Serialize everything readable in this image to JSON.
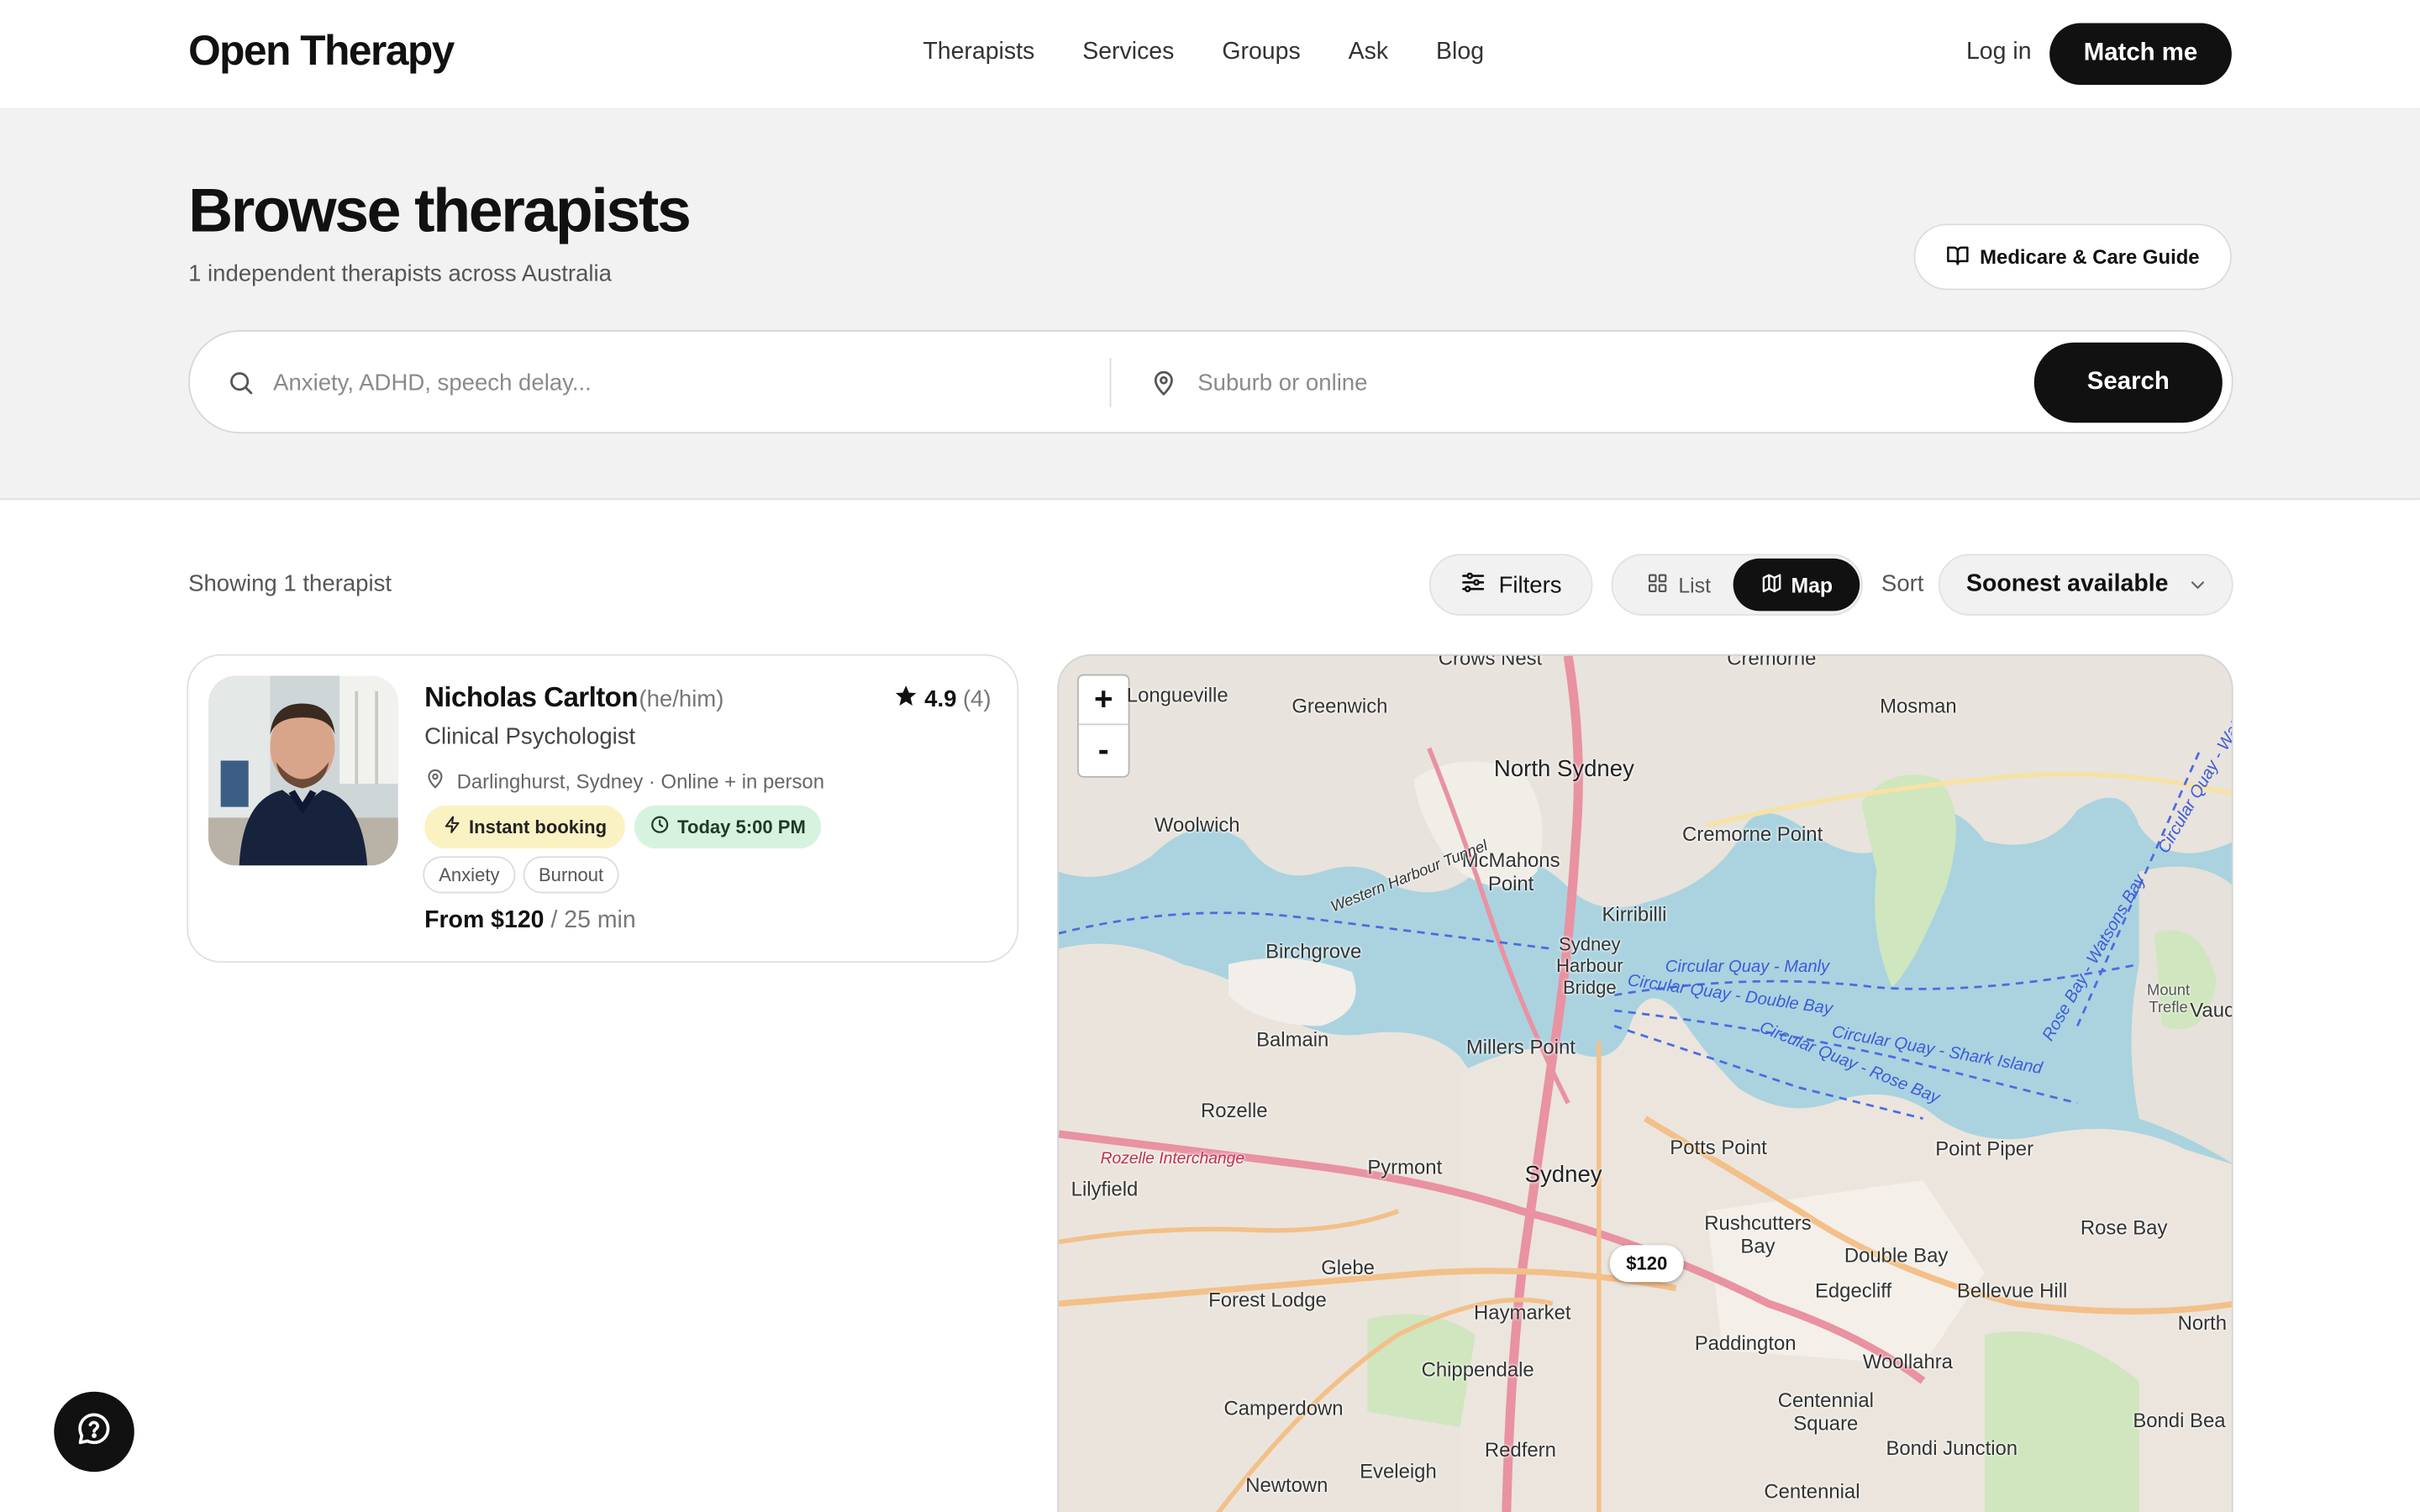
{
  "brand": "Open Therapy",
  "nav": {
    "links": [
      "Therapists",
      "Services",
      "Groups",
      "Ask",
      "Blog"
    ],
    "login": "Log in",
    "cta": "Match me"
  },
  "hero": {
    "title": "Browse therapists",
    "subtitle": "1 independent therapists across Australia",
    "guide_button": "Medicare & Care Guide",
    "search_placeholder": "Anxiety, ADHD, speech delay...",
    "location_placeholder": "Suburb or online",
    "search_button": "Search"
  },
  "results": {
    "count_text": "Showing 1 therapist",
    "filters_label": "Filters",
    "view_list_label": "List",
    "view_map_label": "Map",
    "active_view": "Map",
    "sort_label": "Sort",
    "sort_value": "Soonest available"
  },
  "therapists": [
    {
      "name": "Nicholas Carlton",
      "pronouns": "(he/him)",
      "rating": "4.9",
      "review_count": "(4)",
      "title": "Clinical Psychologist",
      "location": "Darlinghurst, Sydney · Online + in person",
      "badge_instant": "Instant booking",
      "badge_time": "Today 5:00 PM",
      "tags": [
        "Anxiety",
        "Burnout"
      ],
      "price": "From $120",
      "duration": "/ 25 min"
    }
  ],
  "map": {
    "zoom_in": "+",
    "zoom_out": "-",
    "price_pin": "$120",
    "labels": {
      "crows_nest": "Crows Nest",
      "cremorne": "Cremorne",
      "longueville": "Longueville",
      "greenwich": "Greenwich",
      "mosman": "Mosman",
      "north_sydney": "North Sydney",
      "woolwich": "Woolwich",
      "mcmahons_point": "McMahons Point",
      "cremorne_point": "Cremorne Point",
      "kirribilli": "Kirribilli",
      "birchgrove": "Birchgrove",
      "sydney_harbour_bridge": "Sydney Harbour Bridge",
      "balmain": "Balmain",
      "millers_point": "Millers Point",
      "rozelle": "Rozelle",
      "rozelle_interchange": "Rozelle Interchange",
      "lilyfield": "Lilyfield",
      "pyrmont": "Pyrmont",
      "sydney": "Sydney",
      "potts_point": "Potts Point",
      "point_piper": "Point Piper",
      "rose_bay": "Rose Bay",
      "rushcutters_bay": "Rushcutters Bay",
      "double_bay": "Double Bay",
      "glebe": "Glebe",
      "forest_lodge": "Forest Lodge",
      "haymarket": "Haymarket",
      "edgecliff": "Edgecliff",
      "bellevue_hill": "Bellevue Hill",
      "paddington": "Paddington",
      "woollahra": "Woollahra",
      "chippendale": "Chippendale",
      "camperdown": "Camperdown",
      "centennial_square": "Centennial Square",
      "redfern": "Redfern",
      "bondi_junction": "Bondi Junction",
      "newtown": "Newtown",
      "eveleigh": "Eveleigh",
      "centennial": "Centennial",
      "vaucluse": "Vauc",
      "mount_trefle": "Mount Trefle",
      "north": "North",
      "bondi_beach": "Bondi Bea",
      "western_harbour_tunnel": "Western Harbour Tunnel",
      "ferry_manly": "Circular Quay - Manly",
      "ferry_double_bay": "Circular Quay - Double Bay",
      "ferry_shark_island": "Circular Quay - Shark Island",
      "ferry_rose_bay": "Circular Quay - Rose Bay",
      "ferry_watsons_bay": "Circular Quay - Watsons Bay",
      "rose_bay_watsons_bay": "Rose Bay - Watsons Bay"
    }
  }
}
